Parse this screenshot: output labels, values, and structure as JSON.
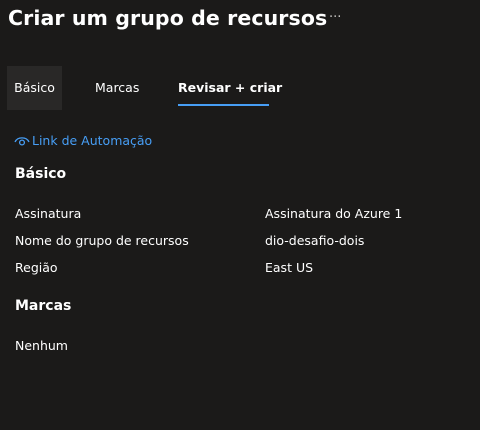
{
  "header": {
    "title": "Criar um grupo de recursos",
    "more_label": "···"
  },
  "tabs": [
    {
      "label": "Básico"
    },
    {
      "label": "Marcas"
    },
    {
      "label": "Revisar + criar",
      "active": true
    }
  ],
  "automation_link": {
    "label": "Link de Automação",
    "icon": "eye-icon"
  },
  "basico": {
    "heading": "Básico",
    "rows": [
      {
        "label": "Assinatura",
        "value": "Assinatura do Azure 1"
      },
      {
        "label": "Nome do grupo de recursos",
        "value": "dio-desafio-dois"
      },
      {
        "label": "Região",
        "value": "East US"
      }
    ]
  },
  "marcas": {
    "heading": "Marcas",
    "value": "Nenhum"
  },
  "colors": {
    "background": "#1b1a19",
    "accent": "#479ef5",
    "selected_tab_bg": "#292827"
  }
}
